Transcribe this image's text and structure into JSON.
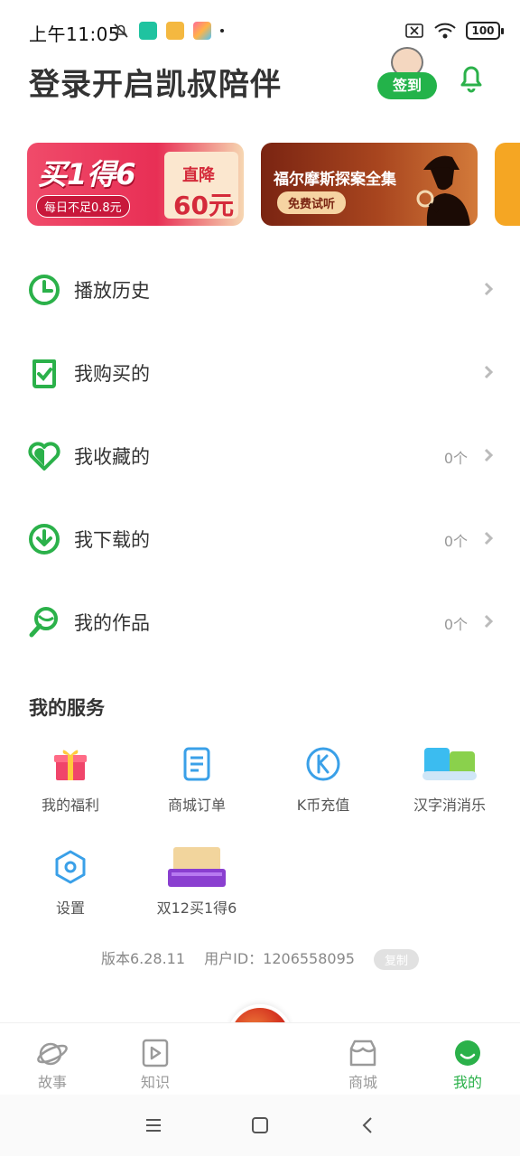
{
  "status_bar": {
    "time": "上午11:05",
    "battery": "100"
  },
  "header": {
    "title": "登录开启凯叔陪伴",
    "signin_label": "签到"
  },
  "banners": [
    {
      "main": "买1得6",
      "sub": "每日不足0.8元",
      "card_title": "直降",
      "card_value": "60元"
    },
    {
      "title": "福尔摩斯探案全集",
      "tag": "免费试听"
    }
  ],
  "menu": {
    "items": [
      {
        "label": "播放历史",
        "count": "",
        "icon": "clock-icon"
      },
      {
        "label": "我购买的",
        "count": "",
        "icon": "shopping-bag-check-icon"
      },
      {
        "label": "我收藏的",
        "count": "0个",
        "icon": "heart-icon"
      },
      {
        "label": "我下载的",
        "count": "0个",
        "icon": "download-icon"
      },
      {
        "label": "我的作品",
        "count": "0个",
        "icon": "microphone-icon"
      }
    ]
  },
  "services": {
    "title": "我的服务",
    "items": [
      {
        "label": "我的福利",
        "icon": "gift-icon"
      },
      {
        "label": "商城订单",
        "icon": "order-document-icon"
      },
      {
        "label": "K币充值",
        "icon": "k-coin-icon"
      },
      {
        "label": "汉字消消乐",
        "icon": "hanzi-game-icon"
      },
      {
        "label": "设置",
        "icon": "settings-hexagon-icon"
      },
      {
        "label": "双12买1得6",
        "icon": "promo-card-icon"
      }
    ]
  },
  "footer": {
    "version": "版本6.28.11",
    "user_id": "用户ID：1206558095",
    "copy_label": "复制"
  },
  "bottom_nav": {
    "items": [
      {
        "label": "故事",
        "icon": "planet-icon",
        "active": false
      },
      {
        "label": "知识",
        "icon": "video-play-icon",
        "active": false
      },
      {
        "label": "商城",
        "icon": "store-icon",
        "active": false
      },
      {
        "label": "我的",
        "icon": "smile-face-icon",
        "active": true
      }
    ]
  },
  "colors": {
    "accent": "#2bb14a",
    "inactive": "#9a9a9a"
  }
}
